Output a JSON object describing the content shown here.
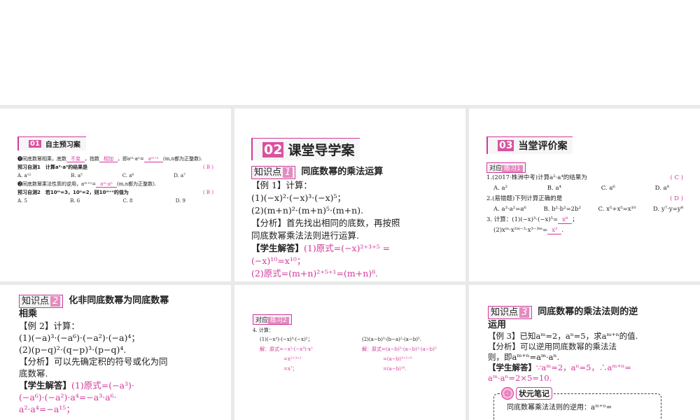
{
  "p1": {
    "num": "01",
    "title": "自主预习案",
    "l1": [
      "❶同底数幂相乘，底数",
      "不变",
      "，指数",
      "相加",
      "，即aᵐ·aⁿ=",
      "aᵐ⁺ⁿ",
      "(m,n都为正整数)."
    ],
    "t1": "预习自测1　计算a²·a³的结果是",
    "a1": "( B )",
    "o1": [
      "A. a¹²",
      "B. a⁵",
      "C. a⁶",
      "D. a⁷"
    ],
    "l2": [
      "❷同底数幂乘法性质的逆用，aᵐ⁺ⁿ=",
      "aᵐ·aⁿ",
      "(m,n都为正整数)."
    ],
    "t2": "预习自测2　若10ᵐ=3，10ⁿ=2，则10ᵐ⁺ⁿ的值为",
    "a2": "( B )",
    "o2": [
      "A. 5",
      "B. 6",
      "C. 8",
      "D. 9"
    ]
  },
  "p2": {
    "num": "02",
    "title": "课堂导学案",
    "kp_label": "知识点",
    "kp_num": "1",
    "kp_title": "同底数幂的乘法运算",
    "lines": [
      "【例 1】计算：",
      "(1)(−x)²·(−x)³·(−x)⁵；",
      "(2)(m+n)²·(m+n)⁵·(m+n).",
      "【分析】首先找出相同的底数，再按照",
      "同底数幂乘法法则进行运算."
    ],
    "ans_label": "【学生解答】",
    "ans": [
      "(1)原式=(−x)²⁺³⁺⁵ =",
      "(−x)¹⁰=x¹⁰；",
      "(2)原式=(m+n)²⁺⁵⁺¹=(m+n)⁸."
    ]
  },
  "p3": {
    "num": "03",
    "title": "当堂评价案",
    "tag": "对应",
    "tag2": "练习1",
    "q1": "1.(2017·株洲中考)计算a²·a⁴的结果为",
    "a1": "( C )",
    "o1": [
      "A. a²",
      "B. a⁴",
      "C. a⁶",
      "D. a⁸"
    ],
    "q2": "2.(易错题)下列计算正确的是",
    "a2": "( D )",
    "o2": [
      "A. a³·a²=a⁶",
      "B. b²·b²=2b²",
      "C. x⁵+x⁵=x¹⁰",
      "D. y⁷·y=y⁸"
    ],
    "q3a": "3. 计算：(1)(−x)³·(−x)⁵=",
    "q3a_ans": "x⁸",
    "q3b": "(2)xᵐ·x²ᵐ⁻³·x³⁻³ᵐ=",
    "q3b_ans": "x²"
  },
  "p4": {
    "kp_label": "知识点",
    "kp_num": "2",
    "kp_title": "化非同底数幂为同底数幂",
    "kp_title2": "相乘",
    "lines": [
      "【例 2】计算：",
      "(1)(−a)³·(−a⁶)·(−a²)·(−a)⁴；",
      "(2)(p−q)²·(q−p)³·(p−q)⁴.",
      "【分析】可以先确定积的符号或化为同",
      "底数幂."
    ],
    "ans_label": "【学生解答】",
    "ans": [
      "(1)原式=(−a³)·",
      "(−a⁶)·(−a²)·a⁴=−a³·a⁶·",
      "a²·a⁴=−a¹⁵；"
    ]
  },
  "p5": {
    "tag": "对应",
    "tag2": "练习2",
    "q": "4. 计算：",
    "c1": [
      "(1)(−x²)·(−x)³·(−x)²；",
      "解：原式=−x²·(−x³)·x²",
      "=x²⁺³⁺²",
      "=x⁷；"
    ],
    "c2": [
      "(2)(a−b)³·(b−a)²·(a−b)⁵.",
      "解：原式=(a−b)³·(a−b)²·(a−b)⁵",
      "=(a−b)³⁺²⁺⁵",
      "=(a−b)¹⁰."
    ]
  },
  "p6": {
    "kp_label": "知识点",
    "kp_num": "3",
    "kp_title": "同底数幂的乘法法则的逆",
    "kp_title2": "运用",
    "lines": [
      "【例 3】已知aᵐ=2，aⁿ=5，求aᵐ⁺ⁿ的值.",
      "【分析】可以逆用同底数幂的乘法法",
      "则，即aᵐ⁺ⁿ=aᵐ·aⁿ."
    ],
    "ans_label": "【学生解答】",
    "ans": [
      "∵aᵐ=2，aⁿ=5，∴aᵐ⁺ⁿ=",
      "aᵐ·aⁿ=2×5=10."
    ],
    "note_title": "状元笔记",
    "note": "同底数幂乘法法则的逆用：aᵐ⁺ⁿ="
  }
}
